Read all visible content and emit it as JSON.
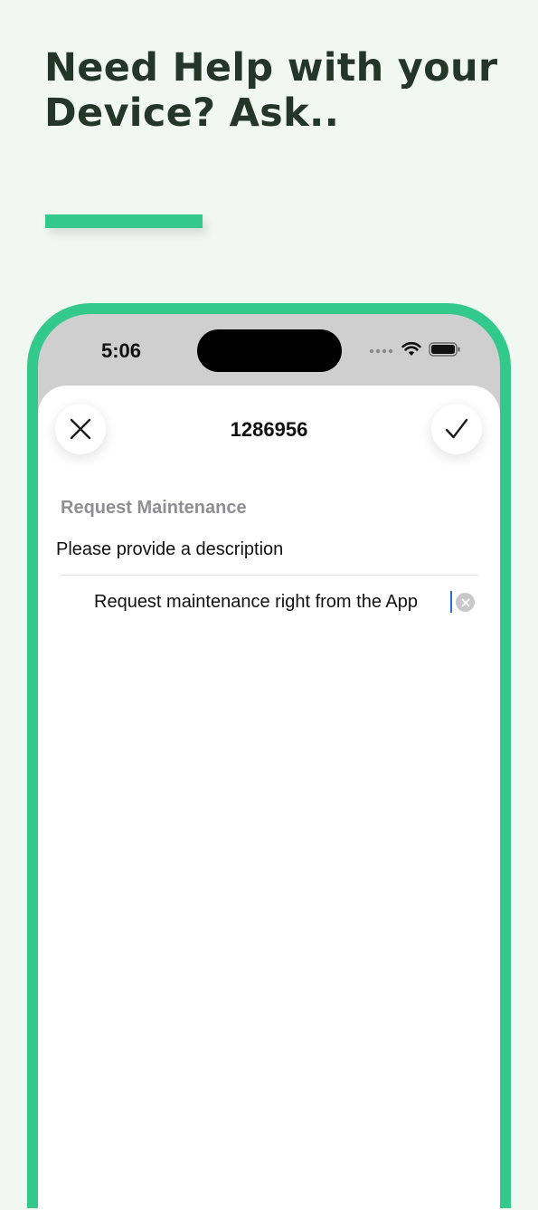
{
  "promo": {
    "headline_line1": "Need Help with your",
    "headline_line2": "Device? Ask..",
    "accent_color": "#33c98d"
  },
  "status_bar": {
    "time": "5:06"
  },
  "nav": {
    "title": "1286956",
    "close_icon": "close-icon",
    "confirm_icon": "checkmark-icon"
  },
  "form": {
    "section_title": "Request Maintenance",
    "field_label": "Please provide a description",
    "description_value": "Request maintenance right from the App"
  }
}
